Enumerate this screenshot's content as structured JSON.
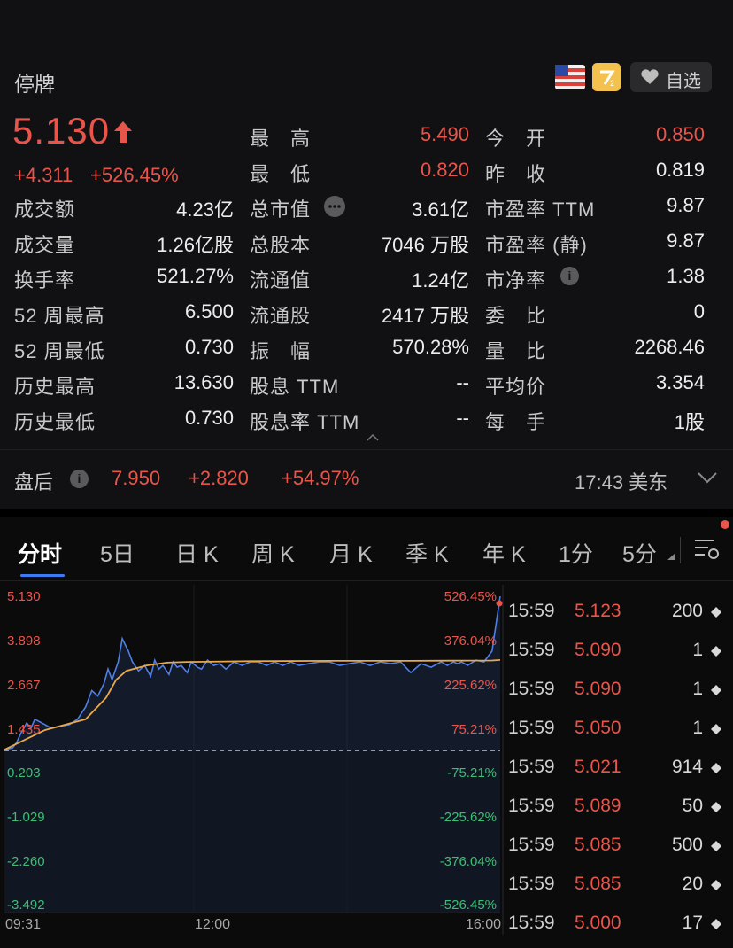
{
  "header": {
    "status": "停牌",
    "watch_label": "自选"
  },
  "quote": {
    "price": "5.130",
    "change": "+4.311",
    "change_pct": "+526.45%"
  },
  "stats": {
    "col1": [
      {
        "label": "成交额",
        "value": "4.23亿"
      },
      {
        "label": "成交量",
        "value": "1.26亿股"
      },
      {
        "label": "换手率",
        "value": "521.27%"
      },
      {
        "label": "52 周最高",
        "value": "6.500"
      },
      {
        "label": "52 周最低",
        "value": "0.730"
      },
      {
        "label": "历史最高",
        "value": "13.630"
      },
      {
        "label": "历史最低",
        "value": "0.730"
      }
    ],
    "col2": [
      {
        "label": "最　高",
        "value": "5.490"
      },
      {
        "label": "最　低",
        "value": "0.820"
      },
      {
        "label": "总市值",
        "value": "3.61亿"
      },
      {
        "label": "总股本",
        "value": "7046 万股"
      },
      {
        "label": "流通值",
        "value": "1.24亿"
      },
      {
        "label": "流通股",
        "value": "2417 万股"
      },
      {
        "label": "振　幅",
        "value": "570.28%"
      },
      {
        "label": "股息 TTM",
        "value": "--"
      },
      {
        "label": "股息率 TTM",
        "value": "--"
      }
    ],
    "col3": [
      {
        "label": "今　开",
        "value": "0.850"
      },
      {
        "label": "昨　收",
        "value": "0.819"
      },
      {
        "label": "市盈率 TTM",
        "value": "9.87"
      },
      {
        "label": "市盈率 (静)",
        "value": "9.87"
      },
      {
        "label": "市净率",
        "value": "1.38"
      },
      {
        "label": "委　比",
        "value": "0"
      },
      {
        "label": "量　比",
        "value": "2268.46"
      },
      {
        "label": "平均价",
        "value": "3.354"
      },
      {
        "label": "每　手",
        "value": "1股"
      }
    ]
  },
  "after_hours": {
    "label": "盘后",
    "price": "7.950",
    "change": "+2.820",
    "change_pct": "+54.97%",
    "time": "17:43 美东"
  },
  "tabs": [
    "分时",
    "5日",
    "日 K",
    "周 K",
    "月 K",
    "季 K",
    "年 K",
    "1分",
    "5分"
  ],
  "chart_data": {
    "type": "line",
    "y_left_labels": [
      "5.130",
      "3.898",
      "2.667",
      "1.435",
      "0.203",
      "-1.029",
      "-2.260",
      "-3.492"
    ],
    "y_right_labels": [
      "526.45%",
      "376.04%",
      "225.62%",
      "75.21%",
      "-75.21%",
      "-225.62%",
      "-376.04%",
      "-526.45%"
    ],
    "x_labels": [
      "09:31",
      "12:00",
      "16:00"
    ],
    "ylim": [
      -3.492,
      5.13
    ],
    "baseline": 0.819,
    "series": [
      {
        "x": [
          0,
          4,
          6,
          8,
          11,
          13,
          15,
          20,
          23,
          27,
          32,
          36,
          40,
          43,
          46,
          49,
          51,
          53,
          56,
          58,
          61,
          63,
          66,
          69,
          72,
          74,
          76,
          78,
          81,
          83,
          85,
          87,
          90,
          92,
          95,
          97,
          100,
          103,
          106,
          109,
          113,
          117,
          121,
          125,
          129,
          133,
          137,
          141,
          145,
          150,
          155,
          160,
          165,
          170,
          175,
          180,
          185,
          190,
          195,
          200,
          205,
          210,
          215,
          218,
          221,
          223,
          225,
          228,
          232,
          236,
          240,
          244
        ],
        "y": [
          0.85,
          0.9,
          1.05,
          1.3,
          1.6,
          1.45,
          1.7,
          1.55,
          1.45,
          1.5,
          1.55,
          1.7,
          2.05,
          2.5,
          2.35,
          2.7,
          3.1,
          2.8,
          3.3,
          3.95,
          3.6,
          3.3,
          3.05,
          3.2,
          2.9,
          3.35,
          3.1,
          3.2,
          2.95,
          3.3,
          3.15,
          3.2,
          3.0,
          3.3,
          3.15,
          3.1,
          3.35,
          3.2,
          3.25,
          3.1,
          3.3,
          3.2,
          3.3,
          3.3,
          3.2,
          3.3,
          3.2,
          3.3,
          3.2,
          3.25,
          3.3,
          3.3,
          3.2,
          3.25,
          3.3,
          3.2,
          3.3,
          3.25,
          3.3,
          3.0,
          3.25,
          3.15,
          3.3,
          3.2,
          3.3,
          3.25,
          3.3,
          3.2,
          3.35,
          3.3,
          3.6,
          5.13
        ]
      },
      {
        "x": [
          0,
          20,
          30,
          40,
          50,
          55,
          60,
          70,
          80,
          90,
          120,
          160,
          200,
          240,
          244
        ],
        "y": [
          0.85,
          1.4,
          1.55,
          1.7,
          2.3,
          2.8,
          3.05,
          3.2,
          3.28,
          3.3,
          3.32,
          3.33,
          3.33,
          3.34,
          3.354
        ]
      }
    ]
  },
  "ticks": [
    {
      "time": "15:59",
      "price": "5.123",
      "vol": "200"
    },
    {
      "time": "15:59",
      "price": "5.090",
      "vol": "1"
    },
    {
      "time": "15:59",
      "price": "5.090",
      "vol": "1"
    },
    {
      "time": "15:59",
      "price": "5.050",
      "vol": "1"
    },
    {
      "time": "15:59",
      "price": "5.021",
      "vol": "914"
    },
    {
      "time": "15:59",
      "price": "5.089",
      "vol": "50"
    },
    {
      "time": "15:59",
      "price": "5.085",
      "vol": "500"
    },
    {
      "time": "15:59",
      "price": "5.085",
      "vol": "20"
    },
    {
      "time": "15:59",
      "price": "5.000",
      "vol": "17"
    }
  ],
  "colors": {
    "up": "#e8554b",
    "down": "#3bbf73",
    "line": "#4f7fe6",
    "avg": "#e9a94a"
  }
}
